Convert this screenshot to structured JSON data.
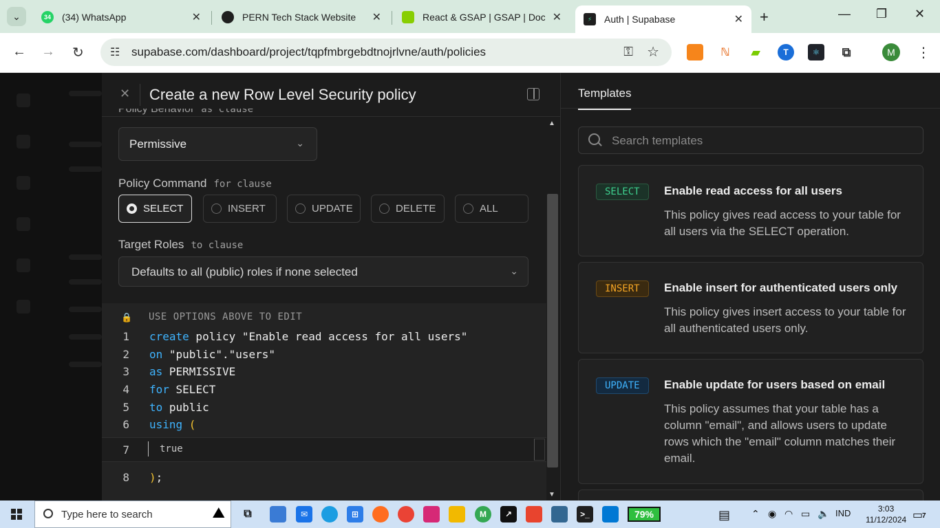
{
  "browser": {
    "tabs": [
      {
        "title": "(34) WhatsApp",
        "badge": "34",
        "color": "#25d366"
      },
      {
        "title": "PERN Tech Stack Website",
        "color": "#1f1f1f"
      },
      {
        "title": "React & GSAP | GSAP | Docs &",
        "color": "#88ce02"
      },
      {
        "title": "Auth | Supabase",
        "color": "#1f1f1f"
      }
    ],
    "url": "supabase.com/dashboard/project/tqpfmbrgebdtnojrlvne/auth/policies",
    "profile_initial": "M"
  },
  "panel": {
    "title": "Create a new Row Level Security policy",
    "clipped_label": "Policy Behavior",
    "clipped_code": "as clause",
    "behavior_value": "Permissive",
    "command_label": "Policy Command",
    "command_code": "for clause",
    "commands": [
      "SELECT",
      "INSERT",
      "UPDATE",
      "DELETE",
      "ALL"
    ],
    "roles_label": "Target Roles",
    "roles_code": "to clause",
    "roles_value": "Defaults to all (public) roles if none selected"
  },
  "editor": {
    "hint": "USE OPTIONS ABOVE TO EDIT",
    "line_numbers": [
      "1",
      "2",
      "3",
      "4",
      "5",
      "6",
      "7",
      "8"
    ],
    "line1_kw": "create",
    "line1_rest": " policy \"Enable read access for all users\"",
    "line2_kw": "on",
    "line2_rest": " \"public\".\"users\"",
    "line3_kw": "as",
    "line3_rest": " PERMISSIVE",
    "line4_kw": "for",
    "line4_rest": " SELECT",
    "line5_kw": "to",
    "line5_rest": " public",
    "line6_kw": "using",
    "line6_paren": " (",
    "line7": "true",
    "line8_paren": ")",
    "line8_rest": ";"
  },
  "templates": {
    "tab_label": "Templates",
    "search_placeholder": "Search templates",
    "cards": [
      {
        "badge": "SELECT",
        "title": "Enable read access for all users",
        "desc": "This policy gives read access to your table for all users via the SELECT operation."
      },
      {
        "badge": "INSERT",
        "title": "Enable insert for authenticated users only",
        "desc": "This policy gives insert access to your table for all authenticated users only."
      },
      {
        "badge": "UPDATE",
        "title": "Enable update for users based on email",
        "desc": "This policy assumes that your table has a column \"email\", and allows users to update rows which the \"email\" column matches their email."
      }
    ]
  },
  "taskbar": {
    "search_text": "Type here to search",
    "battery": "79%",
    "language": "IND",
    "time": "3:03",
    "date": "11/12/2024",
    "notifications": "7"
  }
}
